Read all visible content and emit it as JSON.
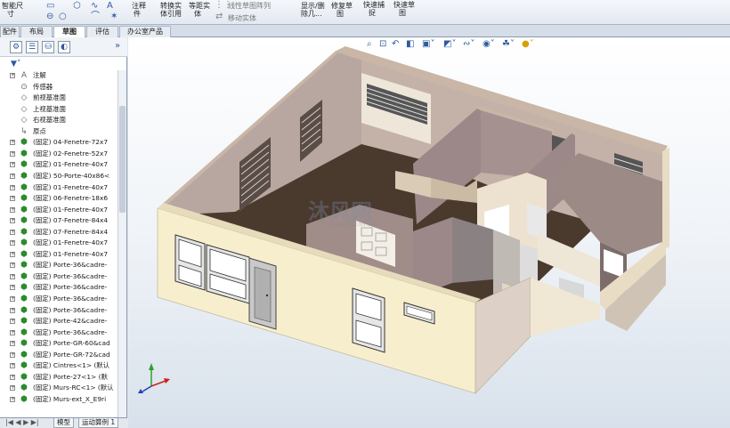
{
  "ribbon": {
    "cmd_a": "智能尺",
    "cmd_a2": "寸",
    "cmd_b": "模型项",
    "cmd_b2": "目",
    "cmd_c": "拼写检",
    "cmd_c2": "查器",
    "cmd_d": "格式涂",
    "cmd_d2": "刷",
    "cmd_e": "注释",
    "cmd_e2": "件",
    "cmd_f": "转换实",
    "cmd_f2": "体引用",
    "cmd_g": "等距实",
    "cmd_g2": "体",
    "cmd_h": "线性草图阵列",
    "cmd_i": "移动实体",
    "cmd_j": "显示/删",
    "cmd_j2": "除几...",
    "cmd_k": "修复草",
    "cmd_k2": "图",
    "cmd_l": "快速捕",
    "cmd_l2": "捉",
    "cmd_m": "快速草",
    "cmd_m2": "图"
  },
  "tabs": [
    "配件",
    "布局",
    "草图",
    "评估",
    "办公室产品"
  ],
  "active_tab": "草图",
  "tree": {
    "items": [
      {
        "label": "注解",
        "icon": "annotation",
        "expandable": true
      },
      {
        "label": "传感器",
        "icon": "sensor",
        "expandable": false
      },
      {
        "label": "前视基准面",
        "icon": "plane",
        "expandable": false
      },
      {
        "label": "上视基准面",
        "icon": "plane",
        "expandable": false
      },
      {
        "label": "右视基准面",
        "icon": "plane",
        "expandable": false
      },
      {
        "label": "原点",
        "icon": "origin",
        "expandable": false
      },
      {
        "label": "(固定) 04-Fenetre-72x7",
        "icon": "part",
        "expandable": true
      },
      {
        "label": "(固定) 02-Fenetre-52x7",
        "icon": "part",
        "expandable": true
      },
      {
        "label": "(固定) 01-Fenetre-40x7",
        "icon": "part",
        "expandable": true
      },
      {
        "label": "(固定) 50-Porte-40x86<",
        "icon": "part",
        "expandable": true
      },
      {
        "label": "(固定) 01-Fenetre-40x7",
        "icon": "part",
        "expandable": true
      },
      {
        "label": "(固定) 06-Fenetre-18x6",
        "icon": "part",
        "expandable": true
      },
      {
        "label": "(固定) 01-Fenetre-40x7",
        "icon": "part",
        "expandable": true
      },
      {
        "label": "(固定) 07-Fenetre-84x4",
        "icon": "part",
        "expandable": true
      },
      {
        "label": "(固定) 07-Fenetre-84x4",
        "icon": "part",
        "expandable": true
      },
      {
        "label": "(固定) 01-Fenetre-40x7",
        "icon": "part",
        "expandable": true
      },
      {
        "label": "(固定) 01-Fenetre-40x7",
        "icon": "part",
        "expandable": true
      },
      {
        "label": "(固定) Porte-36&cadre-",
        "icon": "part",
        "expandable": true
      },
      {
        "label": "(固定) Porte-36&cadre-",
        "icon": "part",
        "expandable": true
      },
      {
        "label": "(固定) Porte-36&cadre-",
        "icon": "part",
        "expandable": true
      },
      {
        "label": "(固定) Porte-36&cadre-",
        "icon": "part",
        "expandable": true
      },
      {
        "label": "(固定) Porte-36&cadre-",
        "icon": "part",
        "expandable": true
      },
      {
        "label": "(固定) Porte-42&cadre-",
        "icon": "part",
        "expandable": true
      },
      {
        "label": "(固定) Porte-36&cadre-",
        "icon": "part",
        "expandable": true
      },
      {
        "label": "(固定) Porte-GR-60&cad",
        "icon": "part",
        "expandable": true
      },
      {
        "label": "(固定) Porte-GR-72&cad",
        "icon": "part",
        "expandable": true
      },
      {
        "label": "(固定) Cintres<1> (默认",
        "icon": "part",
        "expandable": true
      },
      {
        "label": "(固定) Porte-27<1> (默",
        "icon": "part",
        "expandable": true
      },
      {
        "label": "(固定) Murs-RC<1> (默认",
        "icon": "part",
        "expandable": true
      },
      {
        "label": "(固定) Murs-ext_X_E9ri",
        "icon": "part",
        "expandable": true
      }
    ]
  },
  "bottom_tabs": [
    "模型",
    "运动算例 1"
  ],
  "watermark": {
    "text": "沐风网",
    "url": "www.mfcad.com"
  },
  "colors": {
    "floor": "#4a3a2e",
    "wall_top": "#c9b6a6",
    "ext_wall": "#f5edc9",
    "int_wall": "#9c8888",
    "window_frame": "#e6e6e6"
  }
}
